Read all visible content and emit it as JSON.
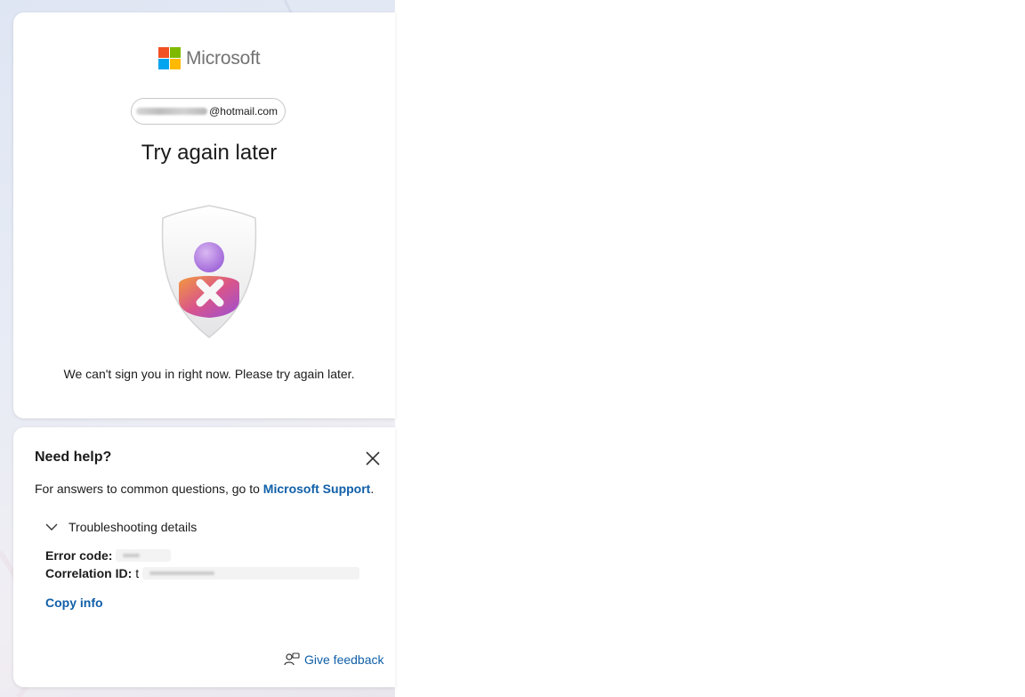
{
  "brand": {
    "name": "Microsoft",
    "colors": {
      "red": "#f25022",
      "green": "#7fba00",
      "blue": "#00a4ef",
      "yellow": "#ffb900"
    }
  },
  "account": {
    "email_suffix": "@hotmail.com"
  },
  "status": {
    "title": "Try again later",
    "message": "We can't sign you in right now. Please try again later.",
    "illustration_icon": "blocked-user-shield-icon"
  },
  "help": {
    "title": "Need help?",
    "text_prefix": "For answers to common questions, go to ",
    "support_link": "Microsoft Support",
    "text_suffix": ".",
    "close_icon": "close-icon",
    "troubleshooting": {
      "label": "Troubleshooting details",
      "expanded": true,
      "error_code_label": "Error code:",
      "correlation_label": "Correlation ID:",
      "correlation_value_visible": "t"
    },
    "copy_info": "Copy info",
    "feedback": {
      "label": "Give feedback",
      "icon": "feedback-icon"
    }
  },
  "theme": {
    "link_color": "#0f5fa8",
    "text_color": "#1b1b1b"
  }
}
